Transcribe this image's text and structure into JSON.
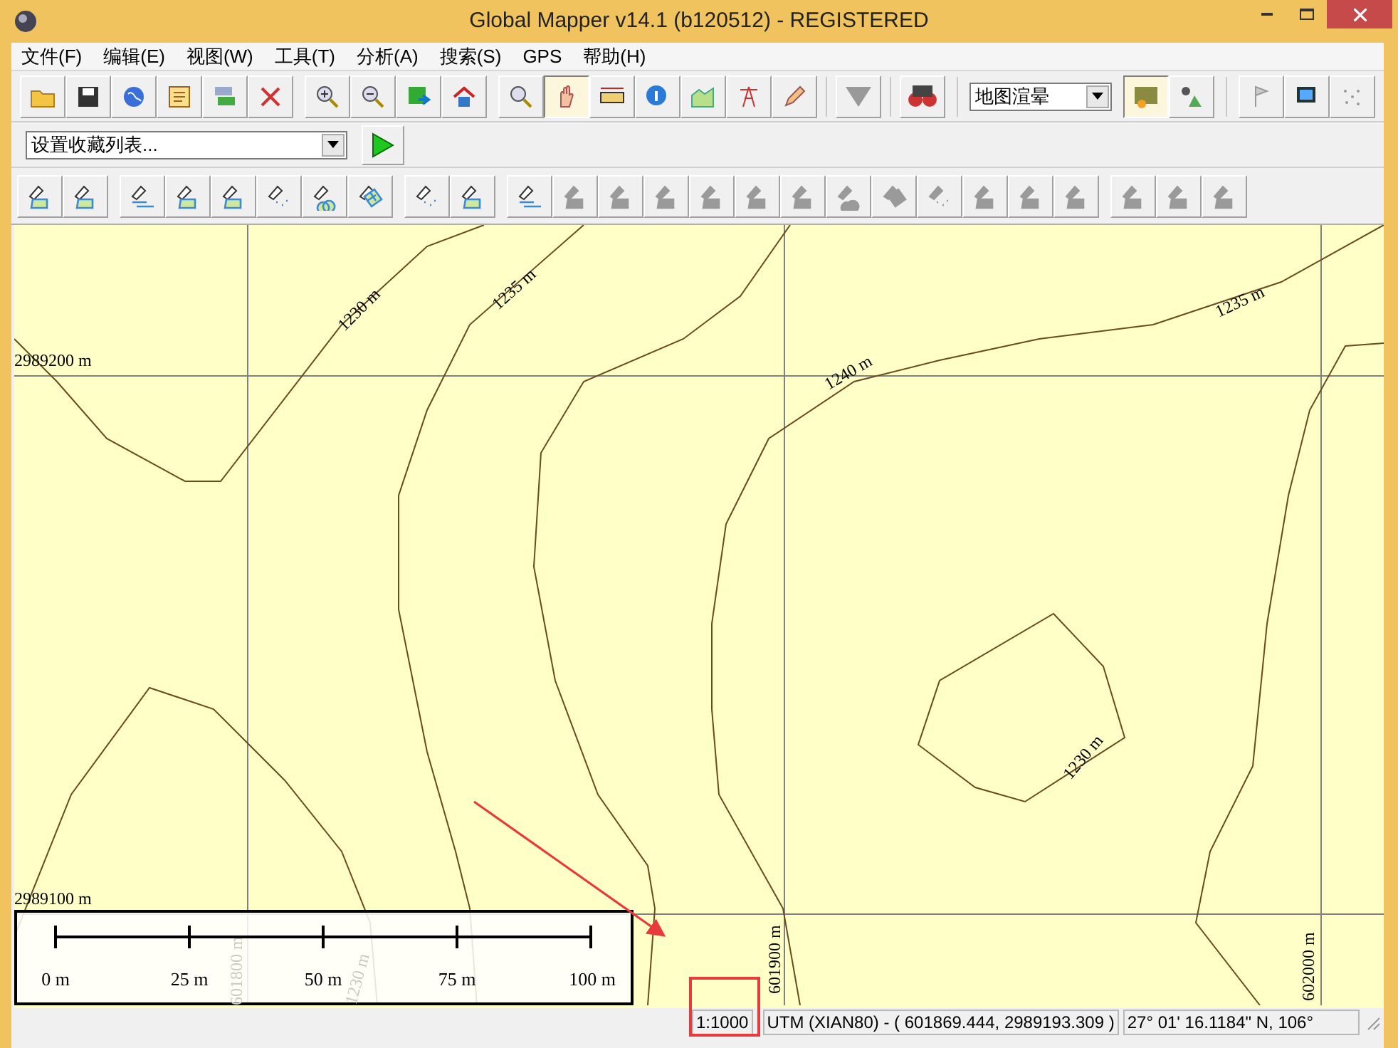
{
  "window": {
    "title": "Global Mapper v14.1 (b120512) - REGISTERED"
  },
  "menu": [
    {
      "label": "文件(F)"
    },
    {
      "label": "编辑(E)"
    },
    {
      "label": "视图(W)"
    },
    {
      "label": "工具(T)"
    },
    {
      "label": "分析(A)"
    },
    {
      "label": "搜索(S)"
    },
    {
      "label": "GPS"
    },
    {
      "label": "帮助(H)"
    }
  ],
  "toolbar_1": {
    "groups": [
      [
        {
          "pressed": false
        },
        {
          "pressed": false
        },
        {
          "pressed": false
        },
        {
          "pressed": false
        },
        {
          "pressed": false
        },
        {
          "pressed": false
        }
      ],
      [
        {
          "pressed": false
        },
        {
          "pressed": false
        },
        {
          "pressed": false
        },
        {
          "pressed": false
        }
      ],
      [
        {
          "pressed": false
        },
        {
          "pressed": true
        },
        {
          "pressed": false
        },
        {
          "pressed": false
        },
        {
          "pressed": false
        },
        {
          "pressed": false
        },
        {
          "pressed": false
        },
        {
          "pressed": false
        },
        {
          "pressed": false
        }
      ]
    ],
    "render_select": {
      "value": "地图渲晕"
    },
    "render_buttons": [
      {
        "pressed": true
      },
      {
        "pressed": false
      }
    ],
    "extra_buttons": [
      {
        "pressed": false
      },
      {
        "pressed": false
      },
      {
        "pressed": false
      }
    ]
  },
  "toolbar_2": {
    "favorites_select": {
      "value": "设置收藏列表..."
    }
  },
  "toolbar_3": {
    "groups": [
      [
        {
          "disabled": false
        },
        {
          "disabled": false
        }
      ],
      [
        {
          "disabled": false
        },
        {
          "disabled": false
        },
        {
          "disabled": false
        },
        {
          "disabled": false
        },
        {
          "disabled": false
        },
        {
          "disabled": false
        }
      ],
      [
        {
          "disabled": false
        },
        {
          "disabled": false
        }
      ],
      [
        {
          "disabled": false
        },
        {
          "disabled": true
        },
        {
          "disabled": true
        },
        {
          "disabled": true
        },
        {
          "disabled": true
        },
        {
          "disabled": true
        },
        {
          "disabled": true
        },
        {
          "disabled": true
        },
        {
          "disabled": true
        },
        {
          "disabled": true
        },
        {
          "disabled": true
        },
        {
          "disabled": true
        },
        {
          "disabled": true
        }
      ],
      [
        {
          "disabled": true
        },
        {
          "disabled": true
        },
        {
          "disabled": true
        }
      ]
    ]
  },
  "map": {
    "grid_labels": [
      {
        "text": "2989200 m"
      },
      {
        "text": "2989100 m"
      },
      {
        "text": "601900 m"
      },
      {
        "text": "602000 m"
      }
    ],
    "contour_labels": [
      {
        "text": "1230 m"
      },
      {
        "text": "1235 m"
      },
      {
        "text": "1240 m"
      },
      {
        "text": "1235 m"
      },
      {
        "text": "1230 m"
      }
    ],
    "faded_labels": [
      {
        "text": "601800 m"
      },
      {
        "text": "1230 m"
      }
    ],
    "scale_bar": {
      "labels": [
        "0 m",
        "25 m",
        "50 m",
        "75 m",
        "100 m"
      ]
    }
  },
  "status_bar": {
    "scale": "1:1000",
    "projection": "UTM (XIAN80) - ( 601869.444, 2989193.309 )",
    "latlon": "27° 01' 16.1184\" N, 106°"
  }
}
